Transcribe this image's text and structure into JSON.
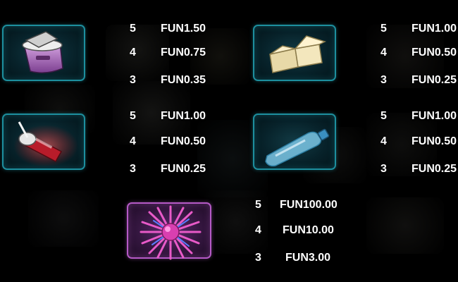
{
  "paytable": [
    {
      "symbol": "trash-can-icon",
      "rows": [
        {
          "count": "5",
          "amount": "FUN1.50"
        },
        {
          "count": "4",
          "amount": "FUN0.75"
        },
        {
          "count": "3",
          "amount": "FUN0.35"
        }
      ]
    },
    {
      "symbol": "takeout-box-icon",
      "rows": [
        {
          "count": "5",
          "amount": "FUN1.00"
        },
        {
          "count": "4",
          "amount": "FUN0.50"
        },
        {
          "count": "3",
          "amount": "FUN0.25"
        }
      ]
    },
    {
      "symbol": "soda-cup-icon",
      "rows": [
        {
          "count": "5",
          "amount": "FUN1.00"
        },
        {
          "count": "4",
          "amount": "FUN0.50"
        },
        {
          "count": "3",
          "amount": "FUN0.25"
        }
      ]
    },
    {
      "symbol": "plastic-bottle-icon",
      "rows": [
        {
          "count": "5",
          "amount": "FUN1.00"
        },
        {
          "count": "4",
          "amount": "FUN0.50"
        },
        {
          "count": "3",
          "amount": "FUN0.25"
        }
      ]
    },
    {
      "symbol": "sea-urchin-icon",
      "rows": [
        {
          "count": "5",
          "amount": "FUN100.00"
        },
        {
          "count": "4",
          "amount": "FUN10.00"
        },
        {
          "count": "3",
          "amount": "FUN3.00"
        }
      ]
    }
  ],
  "colors": {
    "frame_cyan": "#1d8f9e",
    "frame_pink": "#b55ac6",
    "text": "#ffffff"
  }
}
